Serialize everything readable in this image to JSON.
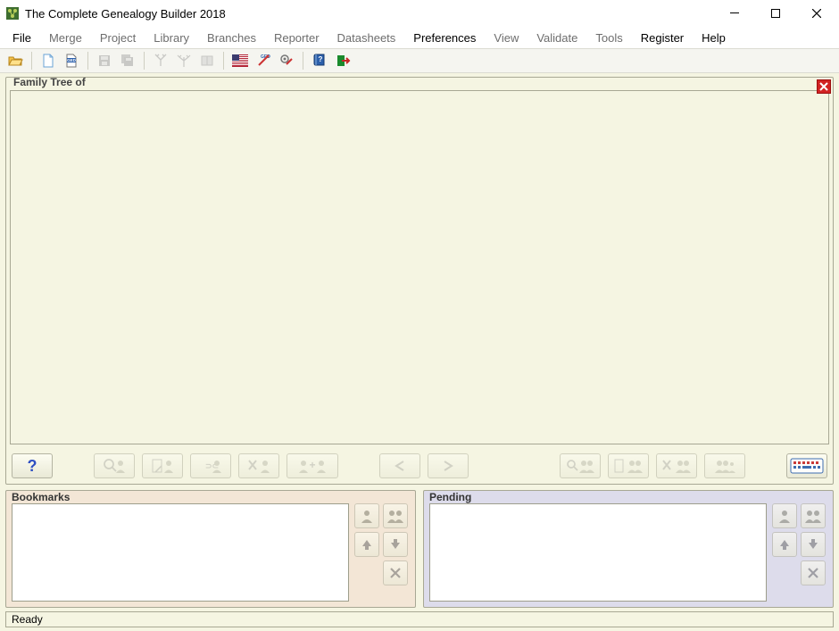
{
  "window": {
    "title": "The Complete Genealogy Builder 2018"
  },
  "menu": {
    "items": [
      {
        "label": "File",
        "enabled": true
      },
      {
        "label": "Merge",
        "enabled": false
      },
      {
        "label": "Project",
        "enabled": false
      },
      {
        "label": "Library",
        "enabled": false
      },
      {
        "label": "Branches",
        "enabled": false
      },
      {
        "label": "Reporter",
        "enabled": false
      },
      {
        "label": "Datasheets",
        "enabled": false
      },
      {
        "label": "Preferences",
        "enabled": true
      },
      {
        "label": "View",
        "enabled": false
      },
      {
        "label": "Validate",
        "enabled": false
      },
      {
        "label": "Tools",
        "enabled": false
      },
      {
        "label": "Register",
        "enabled": true
      },
      {
        "label": "Help",
        "enabled": true
      }
    ]
  },
  "tree_panel": {
    "caption": "Family Tree of"
  },
  "bookmarks_panel": {
    "caption": "Bookmarks"
  },
  "pending_panel": {
    "caption": "Pending"
  },
  "status": {
    "text": "Ready"
  }
}
